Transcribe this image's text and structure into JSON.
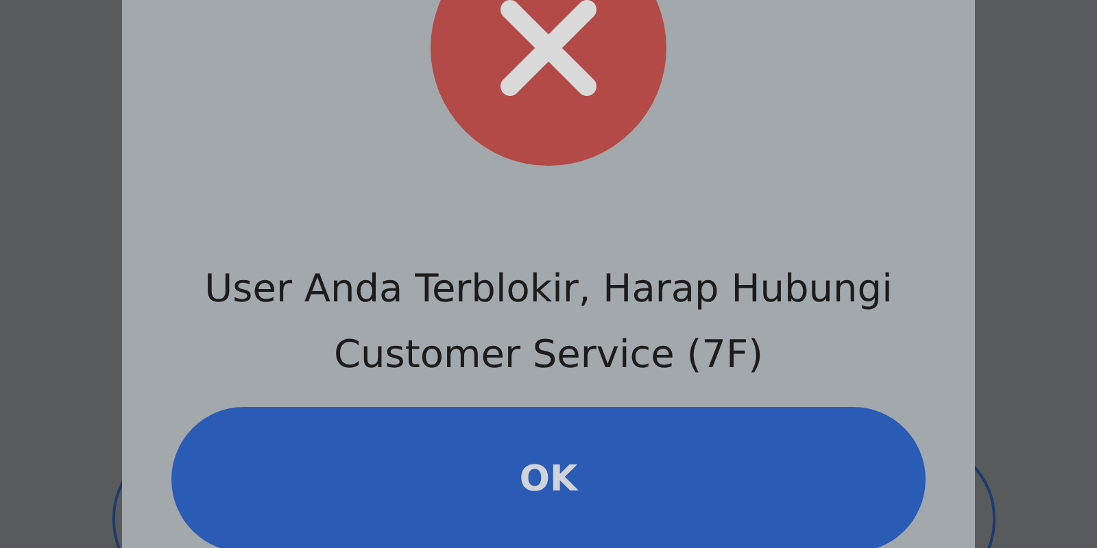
{
  "dialog": {
    "kind": "error",
    "message": "User Anda Terblokir, Harap Hubungi Customer Service (7F)",
    "button": "OK"
  }
}
